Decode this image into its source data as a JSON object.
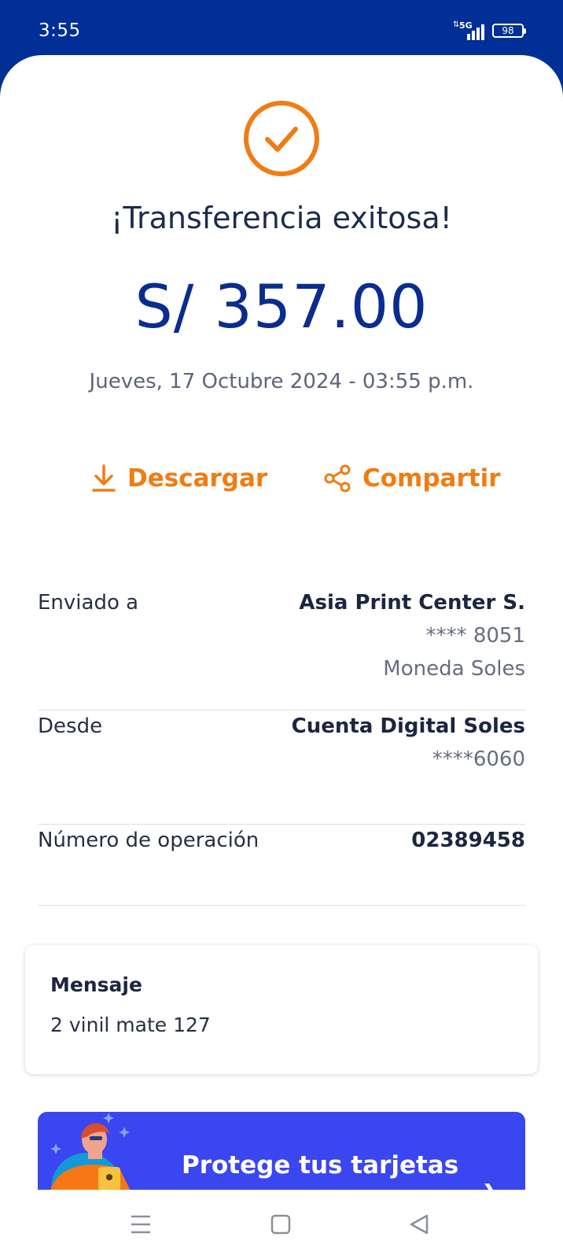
{
  "status_bar": {
    "time": "3:55",
    "network": "5G",
    "battery": "98"
  },
  "receipt": {
    "title": "¡Transferencia exitosa!",
    "amount": "S/ 357.00",
    "datetime": "Jueves, 17 Octubre 2024 - 03:55 p.m."
  },
  "actions": {
    "download_label": "Descargar",
    "share_label": "Compartir"
  },
  "details": {
    "sent_to": {
      "label": "Enviado a",
      "name": "Asia Print Center S.",
      "account": "**** 8051",
      "currency": "Moneda Soles"
    },
    "from": {
      "label": "Desde",
      "account_name": "Cuenta Digital Soles",
      "account": "****6060"
    },
    "operation": {
      "label": "Número de operación",
      "number": "02389458"
    }
  },
  "message": {
    "title": "Mensaje",
    "text": "2 vinil mate 127"
  },
  "promo": {
    "title": "Protege tus tarjetas"
  },
  "icons": {
    "success": "check-circle-icon",
    "download": "download-icon",
    "share": "share-icon",
    "nav_menu": "menu-icon",
    "nav_home": "home-square-icon",
    "nav_back": "back-triangle-icon"
  },
  "colors": {
    "header_blue": "#002f95",
    "accent_orange": "#f07c13",
    "amount_blue": "#0b2c8f",
    "promo_blue": "#3a46ef"
  }
}
